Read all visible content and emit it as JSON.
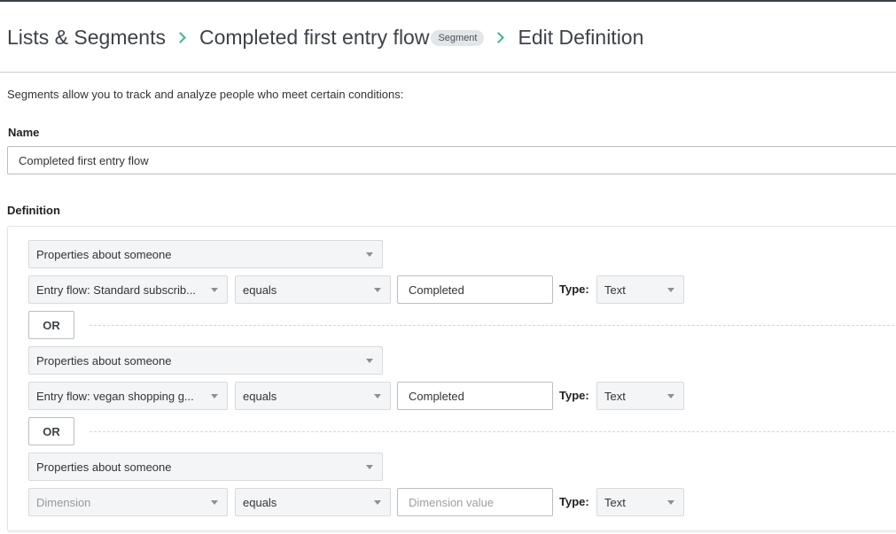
{
  "breadcrumb": {
    "root": "Lists & Segments",
    "item": "Completed first entry flow",
    "badge": "Segment",
    "current": "Edit Definition"
  },
  "intro": "Segments allow you to track and analyze people who meet certain conditions:",
  "name": {
    "label": "Name",
    "value": "Completed first entry flow"
  },
  "definition": {
    "label": "Definition",
    "type_label": "Type:",
    "or_label": "OR",
    "conditions": [
      {
        "category": "Properties about someone",
        "dimension": "Entry flow: Standard subscrib...",
        "operator": "equals",
        "value": "Completed",
        "value_placeholder": "",
        "type": "Text"
      },
      {
        "category": "Properties about someone",
        "dimension": "Entry flow: vegan shopping g...",
        "operator": "equals",
        "value": "Completed",
        "value_placeholder": "",
        "type": "Text"
      },
      {
        "category": "Properties about someone",
        "dimension": "Dimension",
        "operator": "equals",
        "value": "",
        "value_placeholder": "Dimension value",
        "type": "Text"
      }
    ]
  },
  "colors": {
    "accent": "#3fb68b",
    "select_bg": "#f4f5f6",
    "border": "#b9bec3",
    "badge_bg": "#e3e6e9"
  }
}
